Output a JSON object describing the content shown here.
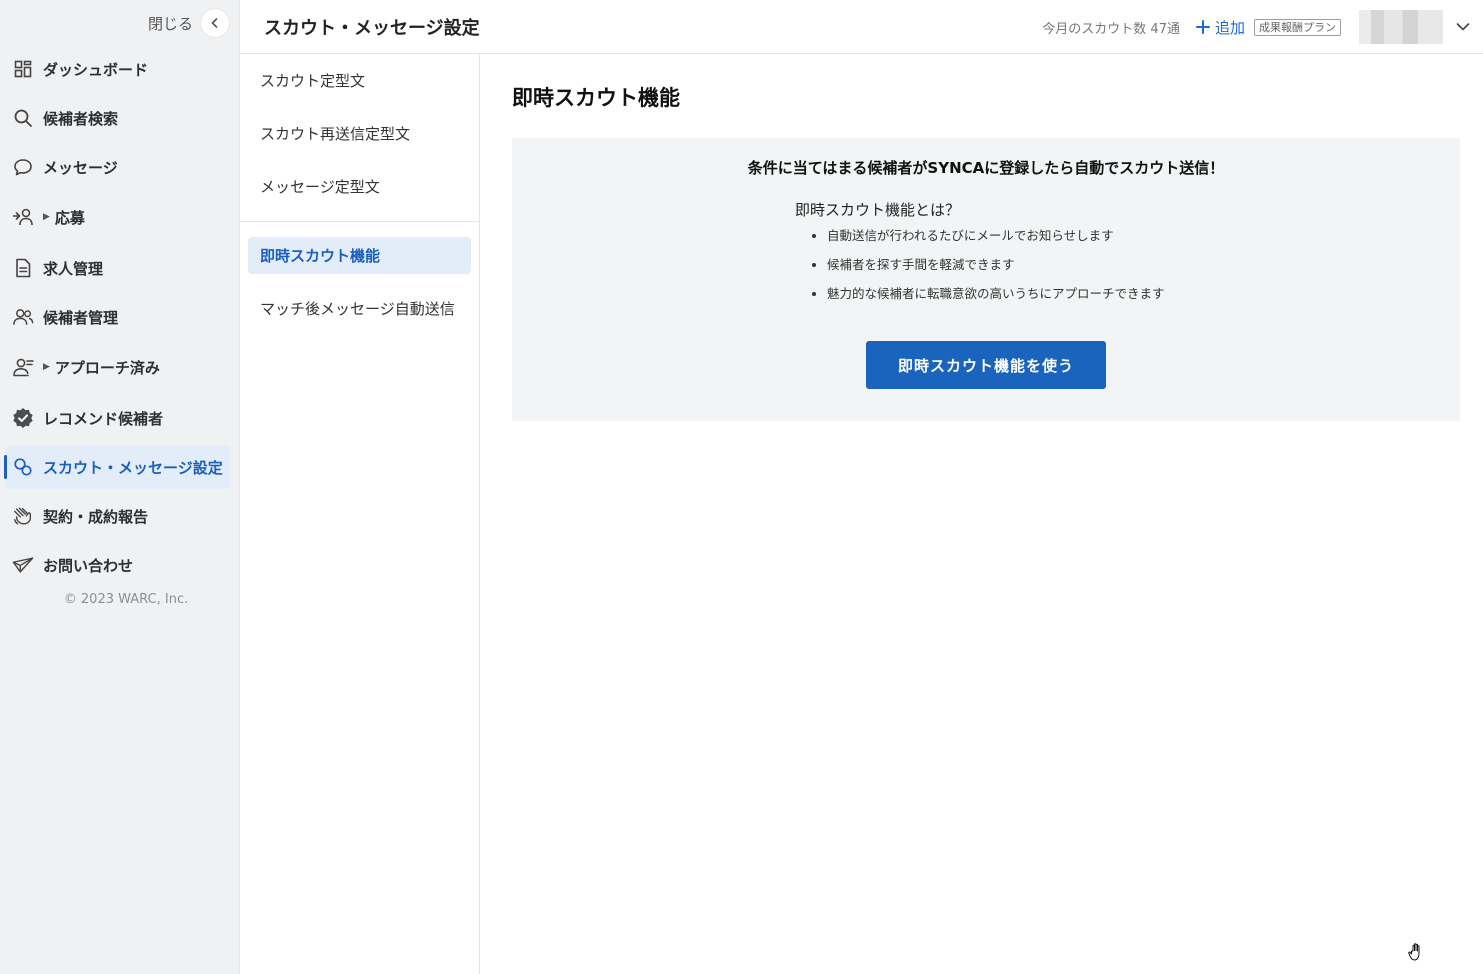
{
  "sidebar": {
    "close_label": "閉じる",
    "items": [
      {
        "label": "ダッシュボード",
        "icon": "dashboard-icon"
      },
      {
        "label": "候補者検索",
        "icon": "search-icon"
      },
      {
        "label": "メッセージ",
        "icon": "message-icon"
      },
      {
        "label": "応募",
        "icon": "application-icon"
      },
      {
        "label": "求人管理",
        "icon": "document-icon"
      },
      {
        "label": "候補者管理",
        "icon": "users-icon"
      },
      {
        "label": "アプローチ済み",
        "icon": "user-check-icon"
      },
      {
        "label": "レコメンド候補者",
        "icon": "verified-badge-icon"
      },
      {
        "label": "スカウト・メッセージ設定",
        "icon": "settings-link-icon",
        "active": true
      },
      {
        "label": "契約・成約報告",
        "icon": "handshake-icon"
      },
      {
        "label": "お問い合わせ",
        "icon": "paper-plane-icon"
      }
    ],
    "copyright": "© 2023 WARC, Inc."
  },
  "header": {
    "title": "スカウト・メッセージ設定",
    "scout_count": "今月のスカウト数 47通",
    "add_label": "追加",
    "plan_badge": "成果報酬プラン"
  },
  "subnav": {
    "items": [
      {
        "label": "スカウト定型文"
      },
      {
        "label": "スカウト再送信定型文"
      },
      {
        "label": "メッセージ定型文"
      },
      {
        "label": "即時スカウト機能",
        "active": true
      },
      {
        "label": "マッチ後メッセージ自動送信"
      }
    ]
  },
  "main": {
    "section_title": "即時スカウト機能",
    "headline": "条件に当てはまる候補者がSYNCAに登録したら自動でスカウト送信！",
    "about_title": "即時スカウト機能とは？",
    "bullets": [
      "自動送信が行われるたびにメールでお知らせします",
      "候補者を探す手間を軽減できます",
      "魅力的な候補者に転職意欲の高いうちにアプローチできます"
    ],
    "cta_label": "即時スカウト機能を使う"
  },
  "colors": {
    "accent": "#1b5fbf",
    "cta_bg": "#1a64bd",
    "sidebar_bg": "#f0f1f3",
    "active_bg": "#e3ecf9",
    "panel_bg": "#f2f5f6"
  }
}
